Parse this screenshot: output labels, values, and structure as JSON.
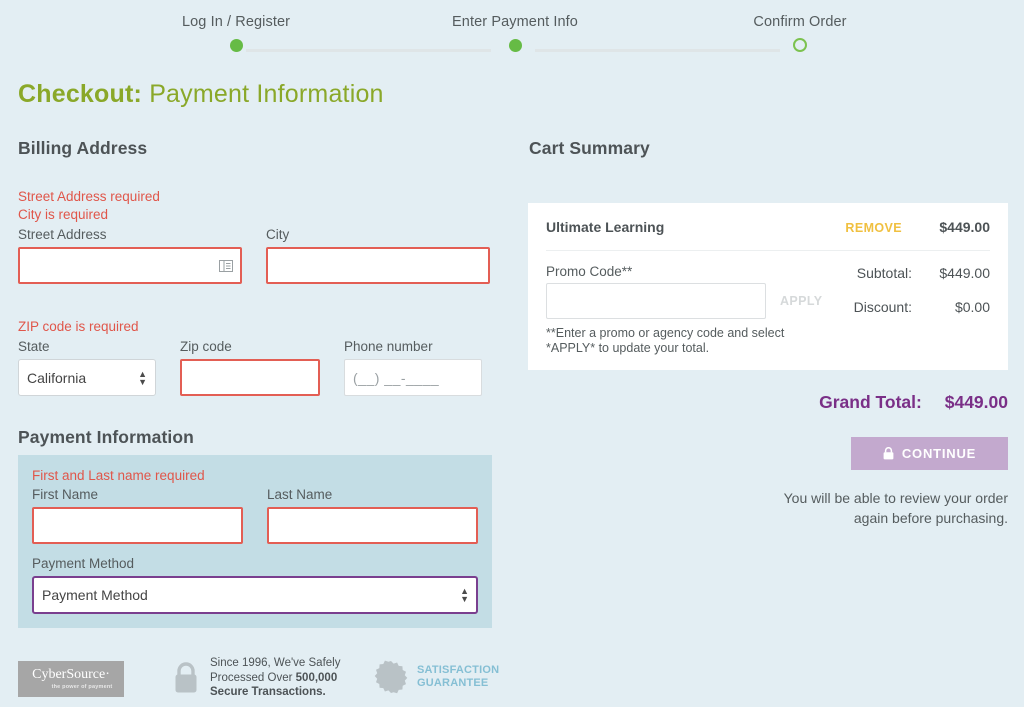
{
  "stepper": {
    "steps": [
      {
        "label": "Log In / Register",
        "state": "complete"
      },
      {
        "label": "Enter Payment Info",
        "state": "complete"
      },
      {
        "label": "Confirm Order",
        "state": "incomplete"
      }
    ]
  },
  "page_title": {
    "prefix": "Checkout:",
    "suffix": "Payment Information"
  },
  "billing": {
    "heading": "Billing Address",
    "errors": {
      "street": "Street Address required",
      "city": "City is required",
      "zip": "ZIP code is required"
    },
    "labels": {
      "street": "Street Address",
      "city": "City",
      "state": "State",
      "zip": "Zip code",
      "phone": "Phone number"
    },
    "values": {
      "street": "",
      "city": "",
      "state": "California",
      "zip": "",
      "phone": ""
    },
    "placeholders": {
      "phone": "(__) __-____"
    },
    "state_options": [
      "California"
    ]
  },
  "payment": {
    "heading": "Payment Information",
    "error": "First and Last name required",
    "labels": {
      "first_name": "First Name",
      "last_name": "Last Name",
      "method": "Payment Method"
    },
    "values": {
      "first_name": "",
      "last_name": "",
      "method": "Payment Method"
    },
    "method_options": [
      "Payment Method"
    ]
  },
  "cart": {
    "heading": "Cart Summary",
    "item": {
      "name": "Ultimate Learning",
      "remove_label": "REMOVE",
      "price": "$449.00"
    },
    "promo": {
      "label": "Promo Code**",
      "value": "",
      "apply_label": "APPLY",
      "note_line1": "**Enter a promo or agency code and select",
      "note_line2": "*APPLY* to update your total."
    },
    "totals": [
      {
        "label": "Subtotal:",
        "value": "$449.00"
      },
      {
        "label": "Discount:",
        "value": "$0.00"
      }
    ],
    "grand_total": {
      "label": "Grand Total:",
      "value": "$449.00"
    },
    "continue_label": "CONTINUE",
    "review_note_line1": "You will be able to review your order",
    "review_note_line2": "again before purchasing."
  },
  "footer": {
    "cybersource": {
      "name": "CyberSource·",
      "tagline": "the power of payment"
    },
    "secure": {
      "line1": "Since 1996, We've Safely",
      "line2_prefix": "Processed Over ",
      "line2_bold": "500,000",
      "line3": "Secure Transactions."
    },
    "guarantee": {
      "line1": "SATISFACTION",
      "line2": "GUARANTEE"
    }
  },
  "colors": {
    "background": "#e3eef3",
    "title": "#8aa829",
    "error": "#e0564a",
    "accent_purple": "#7a2f87",
    "step_green": "#66bb45",
    "remove_gold": "#f0c040"
  }
}
